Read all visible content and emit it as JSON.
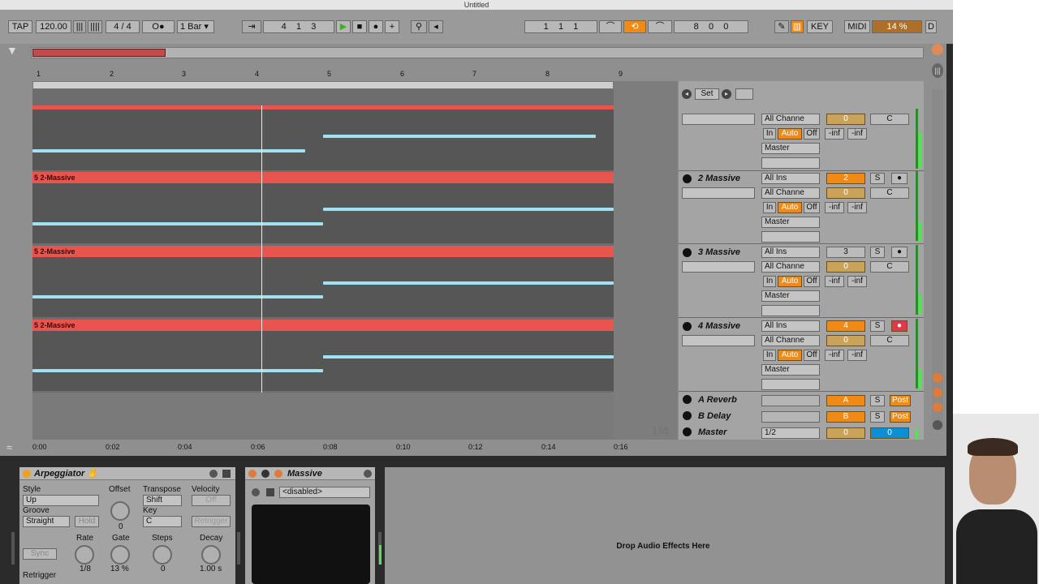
{
  "window": {
    "title": "Untitled"
  },
  "transport": {
    "tap": "TAP",
    "tempo": "120.00",
    "time_sig_num": "4",
    "time_sig_sep": "/",
    "time_sig_den": "4",
    "metronome": "O●",
    "quantize": "1 Bar",
    "position": [
      "4",
      "1",
      "3"
    ],
    "loop_start": [
      "1",
      "1",
      "1"
    ],
    "loop_length": [
      "8",
      "0",
      "0"
    ],
    "key": "KEY",
    "midi": "MIDI",
    "cpu": "14 %",
    "d": "D"
  },
  "ruler": {
    "bars": [
      "1",
      "2",
      "3",
      "4",
      "5",
      "6",
      "7",
      "8",
      "9"
    ]
  },
  "timeline": {
    "times": [
      "0:00",
      "0:02",
      "0:04",
      "0:06",
      "0:08",
      "0:10",
      "0:12",
      "0:14",
      "0:16"
    ]
  },
  "arrangement": {
    "fraction": "1/4",
    "clip_name": "5 2-Massive"
  },
  "mixer": {
    "set_label": "Set",
    "tracks": [
      {
        "name": "",
        "input": "",
        "channel": "All Channe",
        "in": "In",
        "auto": "Auto",
        "off": "Off",
        "vol": "-inf",
        "pan_db": "-inf",
        "num": "",
        "send": "0",
        "pan": "C",
        "output": "Master"
      },
      {
        "name": "2 Massive",
        "input": "All Ins",
        "channel": "All Channe",
        "in": "In",
        "auto": "Auto",
        "off": "Off",
        "vol": "-inf",
        "pan_db": "-inf",
        "num": "2",
        "send": "0",
        "pan": "C",
        "output": "Master",
        "solo": "S"
      },
      {
        "name": "3 Massive",
        "input": "All Ins",
        "channel": "All Channe",
        "in": "In",
        "auto": "Auto",
        "off": "Off",
        "vol": "-inf",
        "pan_db": "-inf",
        "num": "3",
        "send": "0",
        "pan": "C",
        "output": "Master",
        "solo": "S"
      },
      {
        "name": "4 Massive",
        "input": "All Ins",
        "channel": "All Channe",
        "in": "In",
        "auto": "Auto",
        "off": "Off",
        "vol": "-inf",
        "pan_db": "-inf",
        "num": "4",
        "send": "0",
        "pan": "C",
        "output": "Master",
        "solo": "S"
      }
    ],
    "returns": [
      {
        "name": "A Reverb",
        "letter": "A",
        "solo": "S",
        "post": "Post"
      },
      {
        "name": "B Delay",
        "letter": "B",
        "solo": "S",
        "post": "Post"
      }
    ],
    "master": {
      "name": "Master",
      "cue": "1/2",
      "send": "0",
      "vol": "0"
    }
  },
  "arpeggiator": {
    "title": "Arpeggiator",
    "style_label": "Style",
    "style_value": "Up",
    "groove_label": "Groove",
    "groove_value": "Straight",
    "hold": "Hold",
    "offset_label": "Offset",
    "offset_value": "0",
    "transpose_label": "Transpose",
    "transpose_value": "Shift",
    "key_label": "Key",
    "key_value": "C",
    "velocity_label": "Velocity",
    "velocity_value": "Off",
    "retrigger_btn": "Retrigger",
    "rate_label": "Rate",
    "rate_value": "1/8",
    "gate_label": "Gate",
    "gate_value": "13 %",
    "steps_label": "Steps",
    "steps_value": "0",
    "decay_label": "Decay",
    "decay_value": "1.00 s",
    "sync": "Sync",
    "retrigger_label": "Retrigger"
  },
  "massive": {
    "title": "Massive",
    "preset": "<disabled>"
  },
  "drop_zone": {
    "text": "Drop Audio Effects Here"
  },
  "colors": {
    "clip": "#e8544e",
    "note": "#9fe2f2",
    "accent": "#f08a16",
    "blue": "#0d8fd4"
  }
}
